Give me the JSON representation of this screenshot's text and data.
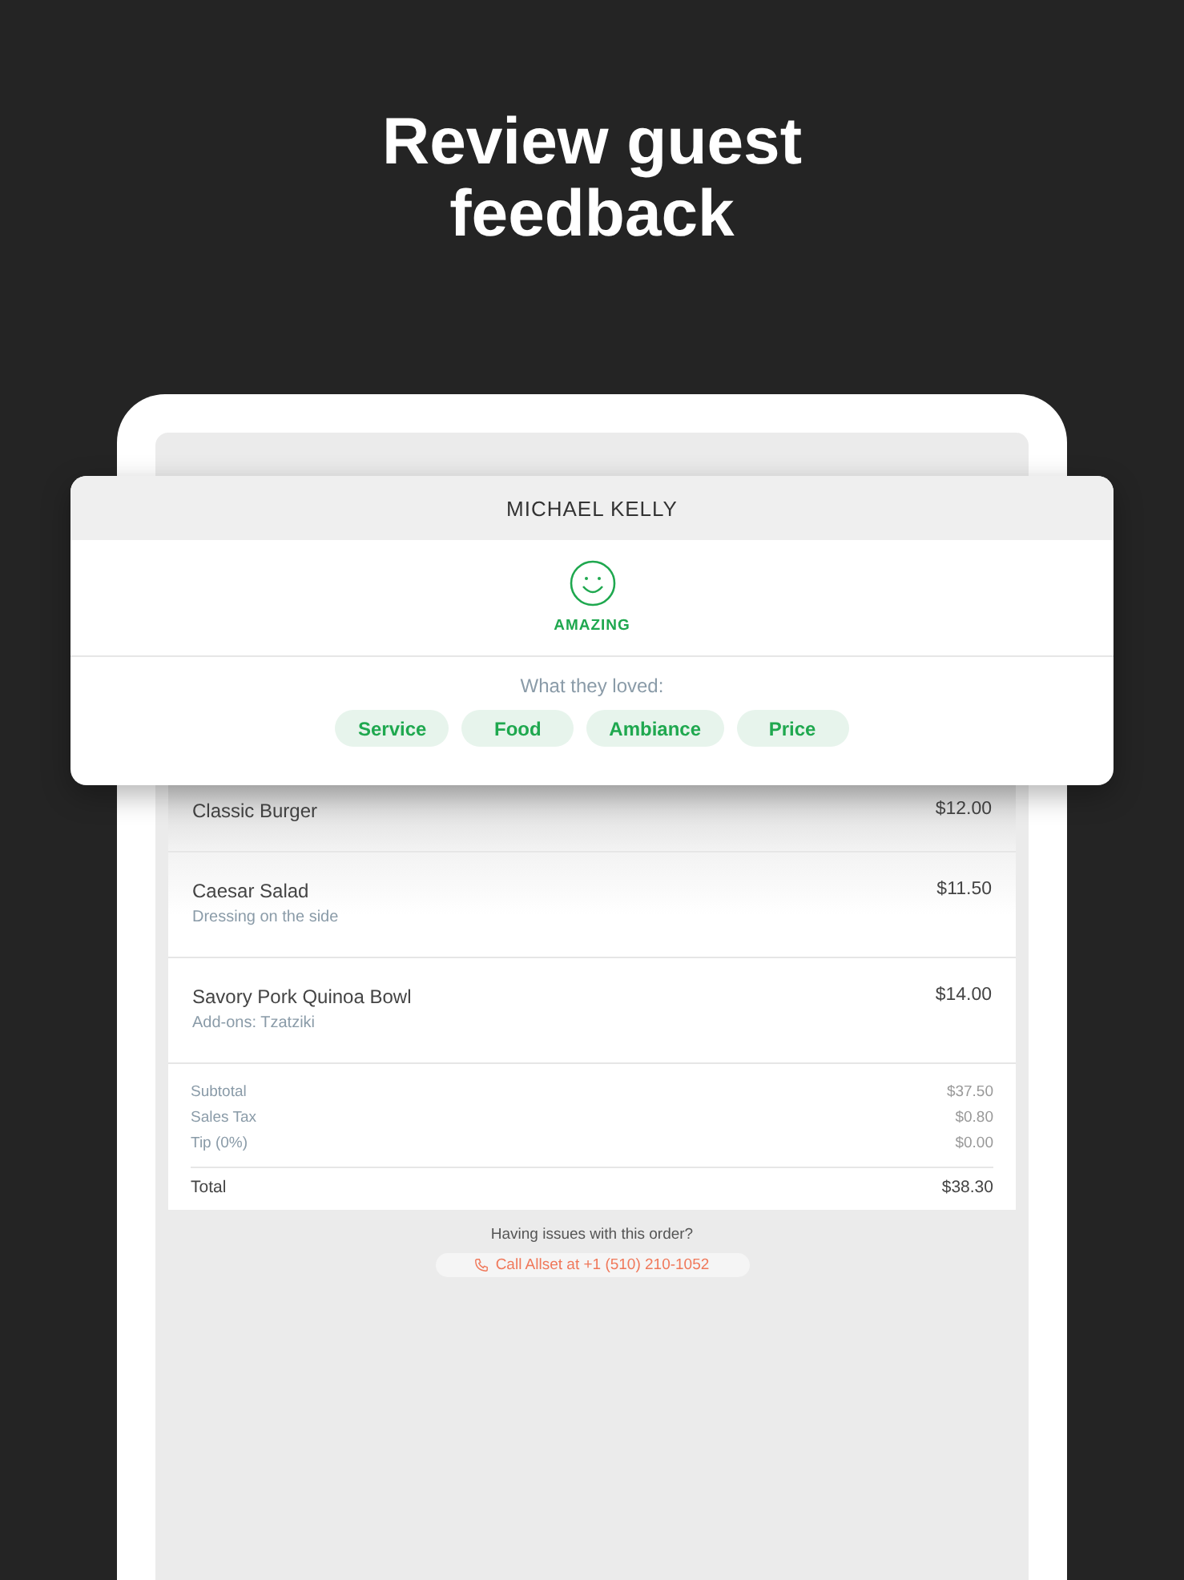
{
  "headline": [
    "Review guest",
    "feedback"
  ],
  "review": {
    "guest_name": "MICHAEL KELLY",
    "rating": {
      "kind": "happy",
      "label": "AMAZING"
    },
    "loved_label": "What they loved:",
    "tags": [
      "Service",
      "Food",
      "Ambiance",
      "Price"
    ]
  },
  "order": {
    "items": [
      {
        "name": "Classic Burger",
        "price": "$12.00"
      },
      {
        "name": "Caesar Salad",
        "note": "Dressing on the side",
        "price": "$11.50"
      },
      {
        "name": "Savory Pork Quinoa Bowl",
        "note": "Add-ons: Tzatziki",
        "price": "$14.00"
      }
    ],
    "charges": [
      {
        "label": "Subtotal",
        "value": "$37.50"
      },
      {
        "label": "Sales Tax",
        "value": "$0.80"
      },
      {
        "label": "Tip (0%)",
        "value": "$0.00"
      }
    ],
    "total": {
      "label": "Total",
      "value": "$38.30"
    }
  },
  "help": {
    "question": "Having issues with this order?",
    "call_button": "Call Allset at +1 (510) 210-1052"
  }
}
